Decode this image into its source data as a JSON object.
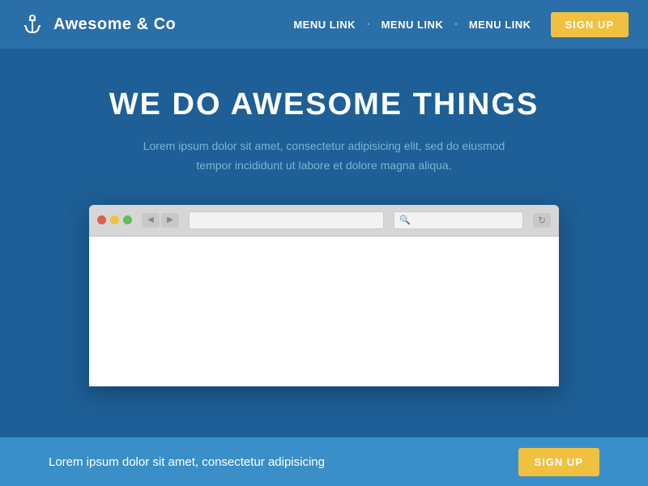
{
  "navbar": {
    "brand": "Awesome & Co",
    "nav_links": [
      "MENU LINK",
      "MENU LINK",
      "MENU LINK"
    ],
    "signup_label": "SIGN UP"
  },
  "hero": {
    "title": "WE DO AWESOME THINGS",
    "subtitle": "Lorem ipsum dolor sit amet, consectetur adipisicing elit, sed do eiusmod tempor incididunt ut labore et dolore magna aliqua."
  },
  "browser": {
    "search_placeholder": "🔍"
  },
  "footer": {
    "text": "Lorem ipsum dolor sit amet, consectetur adipisicing",
    "signup_label": "SIGN UP"
  }
}
